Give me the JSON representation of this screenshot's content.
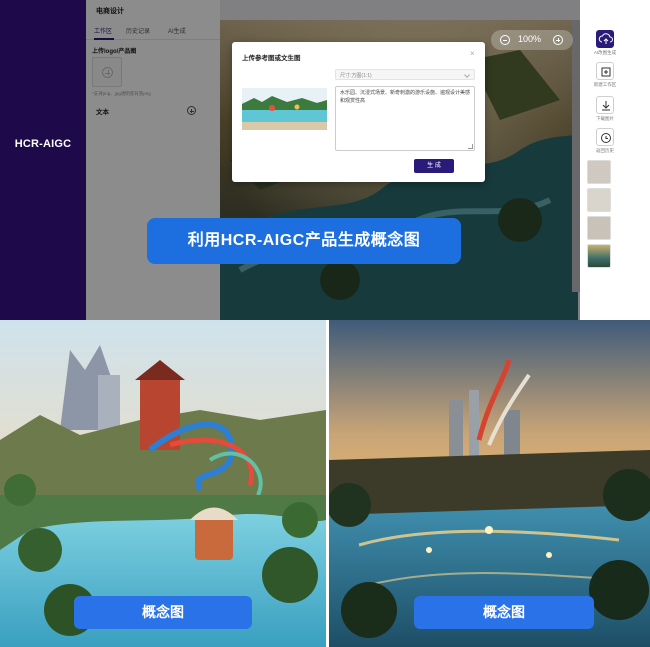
{
  "app": {
    "brand": "HCR-AIGC",
    "sidebar_title": "电商设计",
    "tabs": [
      "工作区",
      "历史记录",
      "AI生成"
    ],
    "upload_label": "上传logo/产品图",
    "upload_hint": "*支持png、jpg透明底背景png",
    "text_label": "文本",
    "zoom_value": "100%",
    "tools": [
      "AI改图生成",
      "新建工作区",
      "下载图片",
      "返回历史"
    ]
  },
  "modal": {
    "title": "上传参考图或文生图",
    "close": "×",
    "size_select": "尺寸:方图(1:1)",
    "prompt": "水乐园、沉浸式场景、新奇刺激的游乐设施、遍观设计美感和观赏性高",
    "generate_label": "生 成"
  },
  "banner": {
    "text": "利用HCR-AIGC产品生成概念图"
  },
  "concepts": [
    {
      "label": "概念图"
    },
    {
      "label": "概念图"
    }
  ],
  "colors": {
    "brand_dark": "#1e0a4a",
    "accent": "#2a1a7a",
    "banner_blue": "#1d6fe0"
  }
}
